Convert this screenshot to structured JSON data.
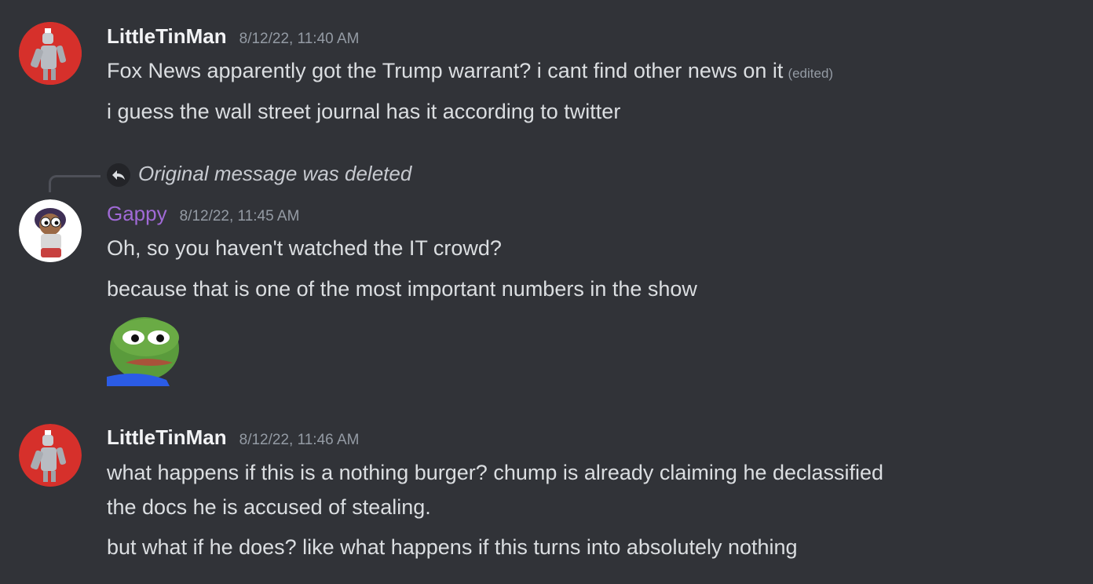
{
  "messages": [
    {
      "username": "LittleTinMan",
      "timestamp": "8/12/22, 11:40 AM",
      "lines": [
        "Fox News apparently got the Trump warrant? i cant find other news on it",
        "i guess the wall street journal has it according to twitter"
      ],
      "edited_label": "(edited)",
      "avatar_icon": "tin-man-avatar-icon"
    },
    {
      "username": "Gappy",
      "username_color": "#a06ad6",
      "timestamp": "8/12/22, 11:45 AM",
      "reply_text": "Original message was deleted",
      "lines": [
        "Oh, so you haven't watched the IT crowd?",
        "because that is one of the most important numbers in the show"
      ],
      "sticker": "pepe-frog-sticker",
      "avatar_icon": "gappy-cartoon-avatar-icon"
    },
    {
      "username": "LittleTinMan",
      "timestamp": "8/12/22, 11:46 AM",
      "lines": [
        "what happens if this is a nothing burger? chump is already claiming he declassified",
        "the docs he is accused of stealing.",
        "but what if he does? like what happens if this turns into absolutely nothing"
      ],
      "avatar_icon": "tin-man-avatar-icon"
    }
  ],
  "colors": {
    "background": "#313338",
    "text": "#dbdee1",
    "muted": "#949ba4"
  }
}
